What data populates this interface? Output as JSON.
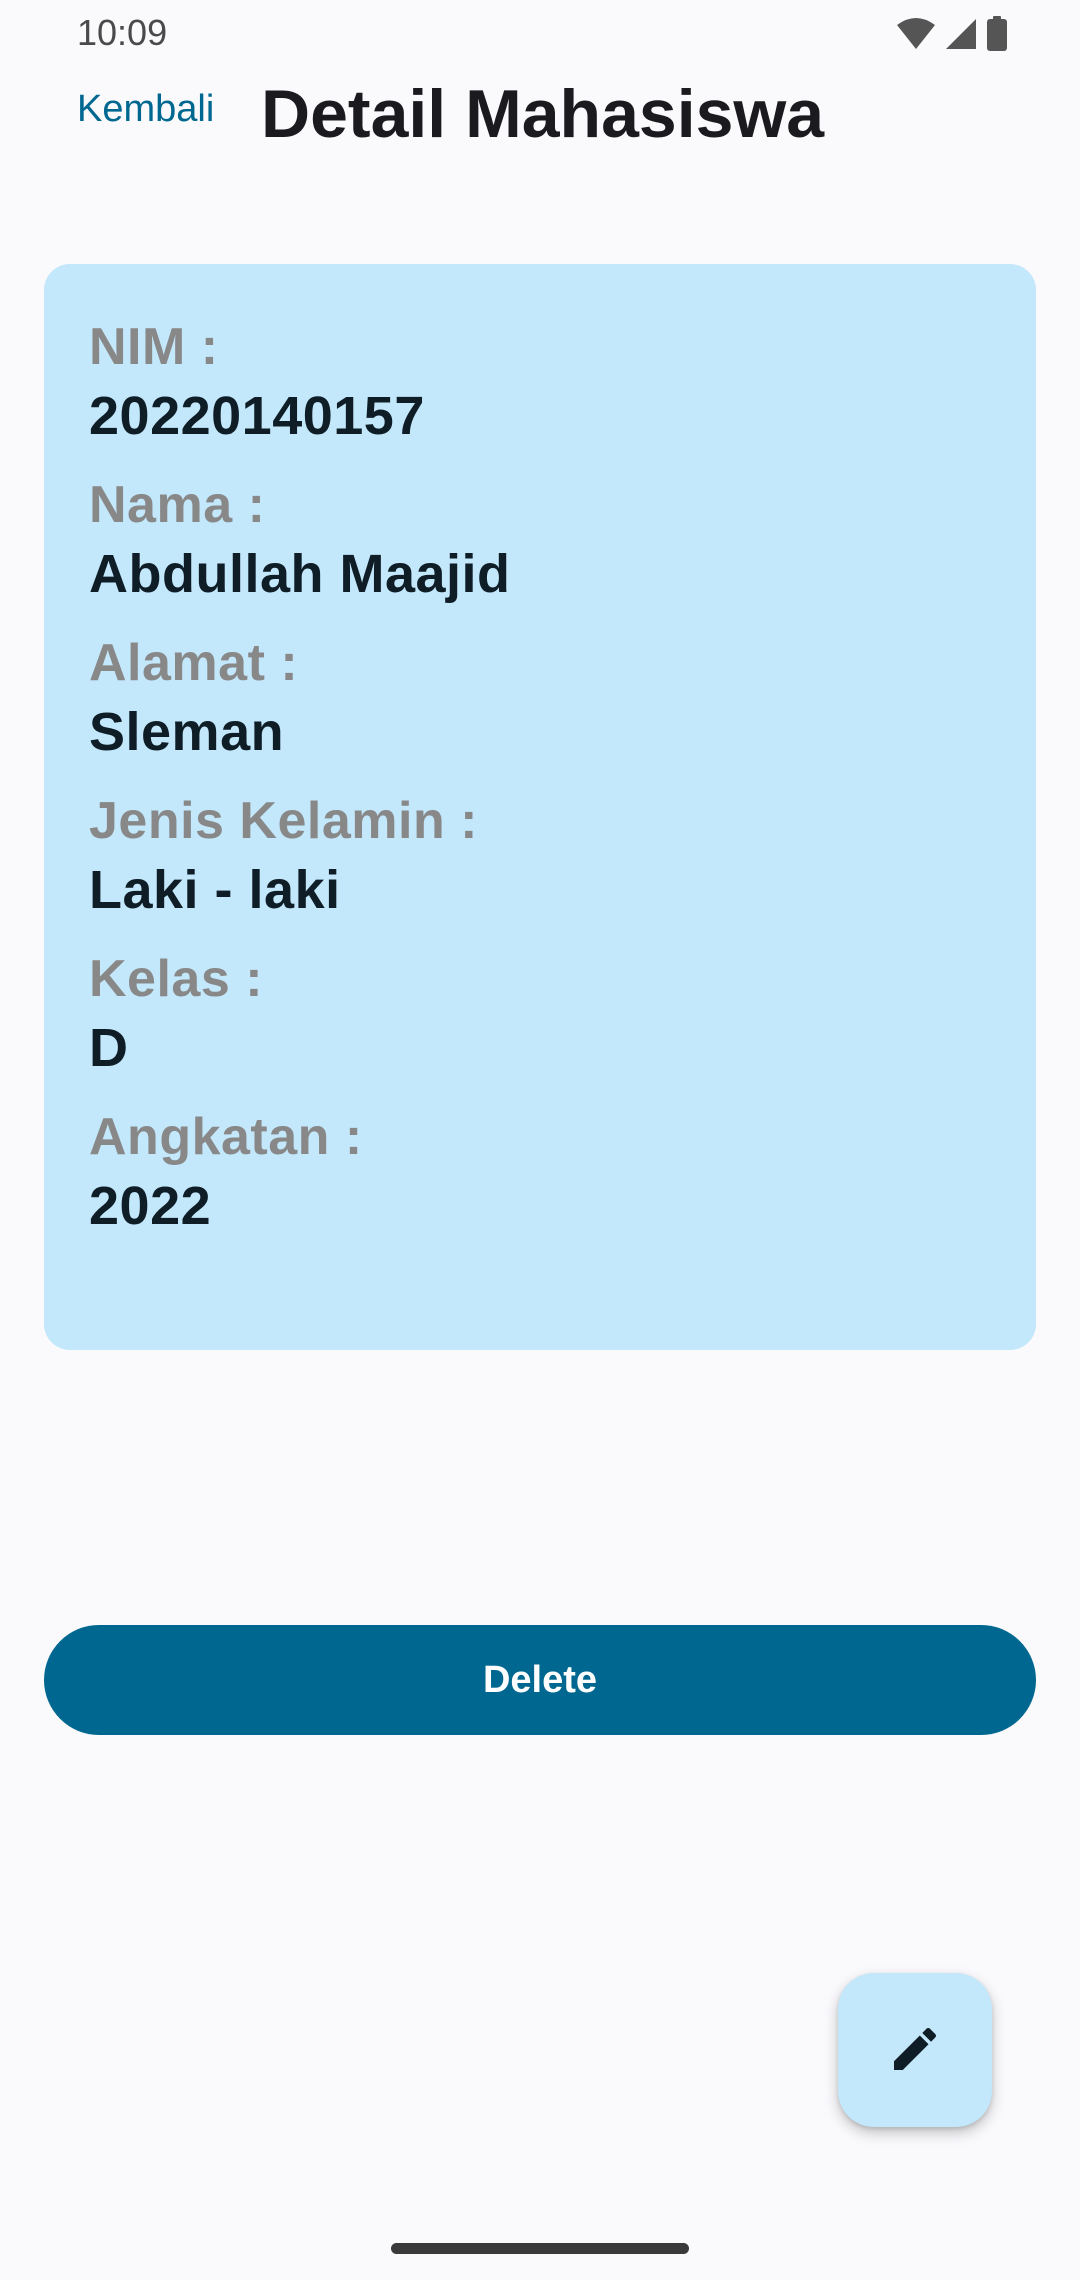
{
  "status_bar": {
    "time": "10:09",
    "icons": [
      "wifi-icon",
      "signal-icon",
      "battery-icon"
    ]
  },
  "top_bar": {
    "back_label": "Kembali",
    "title": "Detail Mahasiswa"
  },
  "student": {
    "fields": [
      {
        "label": "NIM :",
        "value": "20220140157"
      },
      {
        "label": "Nama :",
        "value": "Abdullah Maajid"
      },
      {
        "label": "Alamat :",
        "value": "Sleman"
      },
      {
        "label": "Jenis Kelamin :",
        "value": "Laki - laki"
      },
      {
        "label": "Kelas :",
        "value": "D"
      },
      {
        "label": "Angkatan :",
        "value": "2022"
      }
    ]
  },
  "actions": {
    "delete_label": "Delete",
    "edit_icon": "pencil-icon"
  },
  "colors": {
    "accent": "#006890",
    "card_background": "#C3E7FB",
    "page_background": "#FAF9FC",
    "label_text": "#888888",
    "value_text": "#0F1D26"
  }
}
